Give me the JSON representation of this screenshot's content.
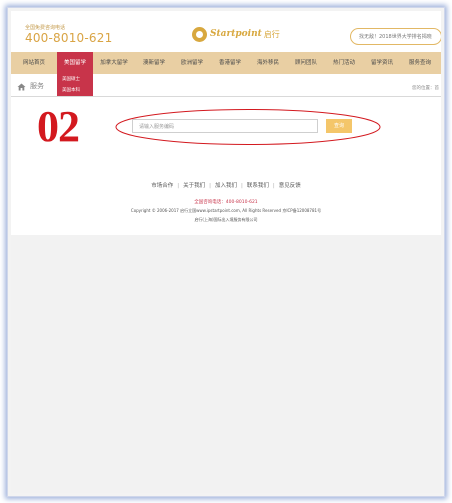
{
  "header": {
    "hotline_caption": "全国免费咨询电话",
    "hotline_number": "400-8010-621",
    "logo_text": "Startpoint",
    "logo_cn": "启行",
    "search_placeholder": "找无敌！2018世界大学排名揭晓"
  },
  "nav": {
    "items": [
      {
        "label": "网站首页"
      },
      {
        "label": "美国留学"
      },
      {
        "label": "加拿大留学"
      },
      {
        "label": "澳新留学"
      },
      {
        "label": "欧洲留学"
      },
      {
        "label": "香港留学"
      },
      {
        "label": "海外移民"
      },
      {
        "label": "顾问团队"
      },
      {
        "label": "热门活动"
      },
      {
        "label": "留学资讯"
      },
      {
        "label": "服务查询"
      }
    ],
    "active_index": 1,
    "dropdown": [
      "美国硕士",
      "美国本科"
    ]
  },
  "breadcrumb": {
    "title": "服务",
    "right_text": "您的位置：首"
  },
  "annotation": {
    "step_number": "02"
  },
  "service_query": {
    "input_placeholder": "请输入服务编码",
    "button_label": "查询"
  },
  "footer": {
    "links": [
      "市场合作",
      "关于我们",
      "加入我们",
      "联系我们",
      "意见反馈"
    ],
    "hotline": "全国咨询电话：400-8010-621",
    "copyright": "Copyright © 2006-2017 启行立国www.ipstartpoint.com, All Rights Reserved 京ICP备12008781号",
    "company": "启行(上海)国际出入境服务有限公司"
  },
  "colors": {
    "brand_gold": "#d8a83f",
    "nav_bg": "#e9cfa3",
    "nav_active": "#c8344a",
    "annotation_red": "#d3191f",
    "button_bg": "#f4c66a"
  }
}
